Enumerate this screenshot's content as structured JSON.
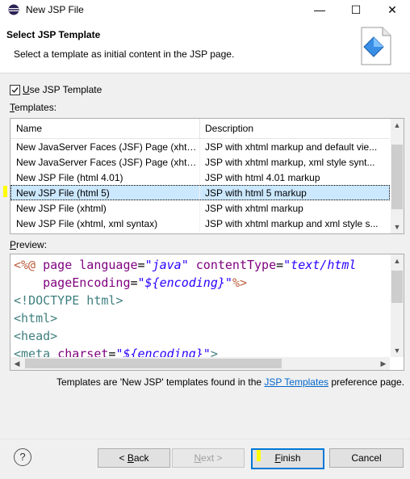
{
  "window": {
    "title": "New JSP File",
    "minimize_glyph": "—",
    "maximize_glyph": "☐",
    "close_glyph": "✕"
  },
  "header": {
    "title": "Select JSP Template",
    "description": "Select a template as initial content in the JSP page."
  },
  "use_template": {
    "checked": true,
    "label_accel": "U",
    "label_rest": "se JSP Template"
  },
  "templates_label_accel": "T",
  "templates_label_rest": "emplates:",
  "table": {
    "columns": [
      "Name",
      "Description"
    ],
    "rows": [
      {
        "name": "New JavaServer Faces (JSF) Page (xhtml)",
        "desc": "JSP with xhtml markup and default vie..."
      },
      {
        "name": "New JavaServer Faces (JSF) Page (xhtml...",
        "desc": "JSP with xhtml markup, xml style synt..."
      },
      {
        "name": "New JSP File (html 4.01)",
        "desc": "JSP with html 4.01 markup"
      },
      {
        "name": "New JSP File (html 5)",
        "desc": "JSP with html 5 markup",
        "selected": true
      },
      {
        "name": "New JSP File (xhtml)",
        "desc": "JSP with xhtml markup"
      },
      {
        "name": "New JSP File (xhtml, xml syntax)",
        "desc": "JSP with xhtml markup and xml style s..."
      }
    ]
  },
  "preview_label_accel": "P",
  "preview_label_rest": "review:",
  "preview": {
    "line1": {
      "open": "<%@",
      "kw": "page",
      "a1": "language",
      "eq1": "=",
      "v1": "\"java\"",
      "a2": "contentType",
      "eq2": "=",
      "v2": "\"text/html"
    },
    "line2": {
      "a": "pageEncoding",
      "eq": "=",
      "v": "\"${encoding}\"",
      "close": "%>"
    },
    "line3": {
      "open": "<!",
      "kw": "DOCTYPE html",
      "close": ">"
    },
    "line4": {
      "open": "<",
      "kw": "html",
      "close": ">"
    },
    "line5": {
      "open": "<",
      "kw": "head",
      "close": ">"
    },
    "line6": {
      "open": "<",
      "kw": "meta",
      "a": "charset",
      "eq": "=",
      "v": "\"${encoding}\"",
      "close": ">"
    }
  },
  "info": {
    "prefix": "Templates are 'New JSP' templates found in the ",
    "link": "JSP Templates",
    "suffix": " preference page."
  },
  "buttons": {
    "help": "?",
    "back_prefix": "< ",
    "back_accel": "B",
    "back_rest": "ack",
    "next_accel": "N",
    "next_rest": "ext >",
    "finish_accel": "F",
    "finish_rest": "inish",
    "cancel": "Cancel"
  },
  "icons": {
    "app": "eclipse-icon",
    "wizard": "jsp-file-wizard-icon"
  },
  "colors": {
    "selection": "#cce8ff",
    "link": "#0066cc",
    "default_button_border": "#0078d7",
    "highlight_marker": "#ffff00"
  }
}
